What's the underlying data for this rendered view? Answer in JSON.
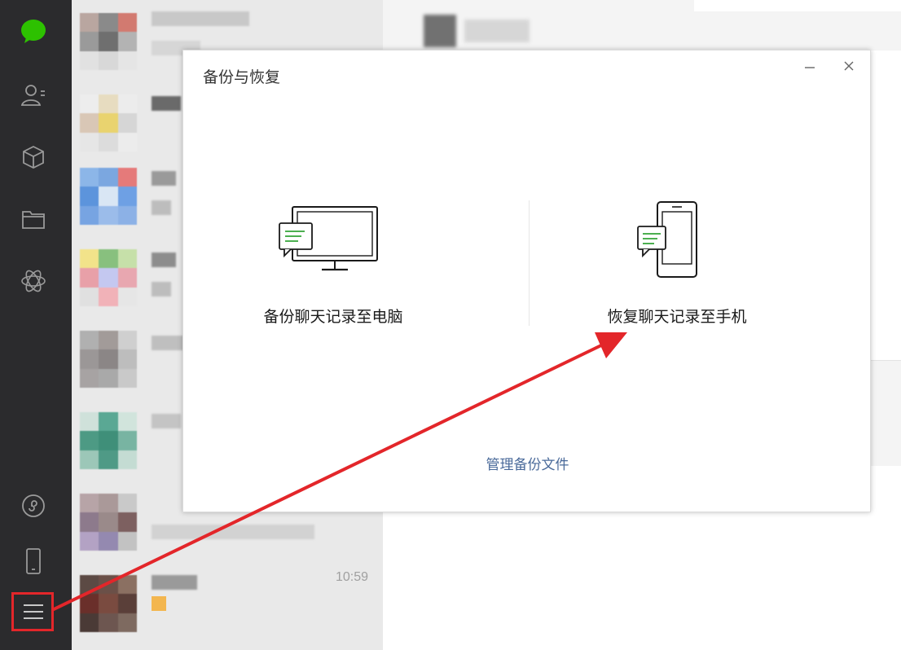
{
  "colors": {
    "sidebar_bg": "#2b2b2d",
    "wechat_green": "#2dc100",
    "annotation_red": "#e3262a",
    "link_blue": "#4a6a9a",
    "icon_green": "#4caf50"
  },
  "sidebar": {
    "items": [
      {
        "icon": "chat-bubble-icon",
        "active": true
      },
      {
        "icon": "contacts-icon"
      },
      {
        "icon": "favorites-cube-icon"
      },
      {
        "icon": "folder-icon"
      },
      {
        "icon": "moments-icon"
      },
      {
        "icon": "mini-program-icon"
      },
      {
        "icon": "phone-icon"
      },
      {
        "icon": "menu-icon",
        "highlighted": true
      }
    ]
  },
  "chat_list": {
    "last_item_time": "10:59"
  },
  "dialog": {
    "title": "备份与恢复",
    "minimize_icon": "minimize-icon",
    "close_icon": "close-icon",
    "backup_option": {
      "label": "备份聊天记录至电脑",
      "icon": "monitor-chat-icon"
    },
    "restore_option": {
      "label": "恢复聊天记录至手机",
      "icon": "phone-chat-icon"
    },
    "manage_link": "管理备份文件"
  }
}
